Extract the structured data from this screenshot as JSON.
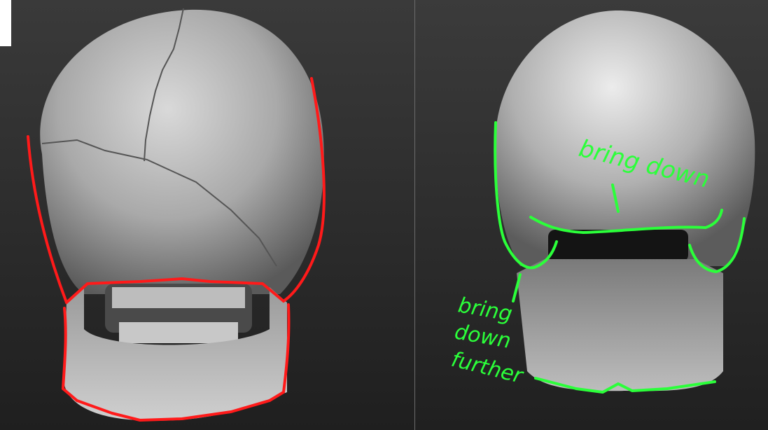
{
  "annotations": {
    "note_top": "bring down",
    "note_bottom_line1": "bring",
    "note_bottom_line2": "down",
    "note_bottom_line3": "further"
  },
  "colors": {
    "outline_red": "#ff1a1a",
    "outline_green": "#2bff3a",
    "background": "#2a2a2a"
  }
}
